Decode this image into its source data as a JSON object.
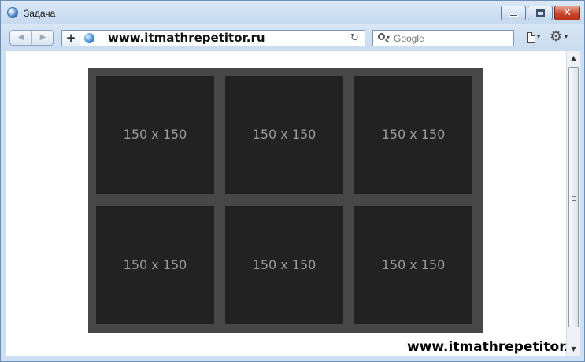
{
  "window": {
    "title": "Задача",
    "buttons": {
      "minimize": "minimize",
      "maximize": "maximize",
      "close": "✕"
    }
  },
  "toolbar": {
    "back_icon": "◀",
    "forward_icon": "▶",
    "add_label": "+",
    "url": "www.itmathrepetitor.ru",
    "reload_icon": "↻",
    "search_placeholder": "Google",
    "search_dropdown": "▾",
    "page_menu_dropdown": "▾",
    "tools_icon": "⚙",
    "tools_dropdown": "▾"
  },
  "icons": [
    "browser-app-icon",
    "globe-icon",
    "search-icon",
    "page-icon",
    "gear-icon"
  ],
  "page": {
    "tiles": [
      {
        "label": "150 x 150"
      },
      {
        "label": "150 x 150"
      },
      {
        "label": "150 x 150"
      },
      {
        "label": "150 x 150"
      },
      {
        "label": "150 x 150"
      },
      {
        "label": "150 x 150"
      }
    ],
    "watermark": "www.itmathrepetitor.ru"
  },
  "scrollbar": {
    "up_icon": "▲",
    "down_icon": "▼"
  },
  "colors": {
    "frame": "#474747",
    "tile": "#222222",
    "tile_text": "#9a9a9a",
    "chrome": "#cfe0f3",
    "close_button": "#c9462d"
  }
}
